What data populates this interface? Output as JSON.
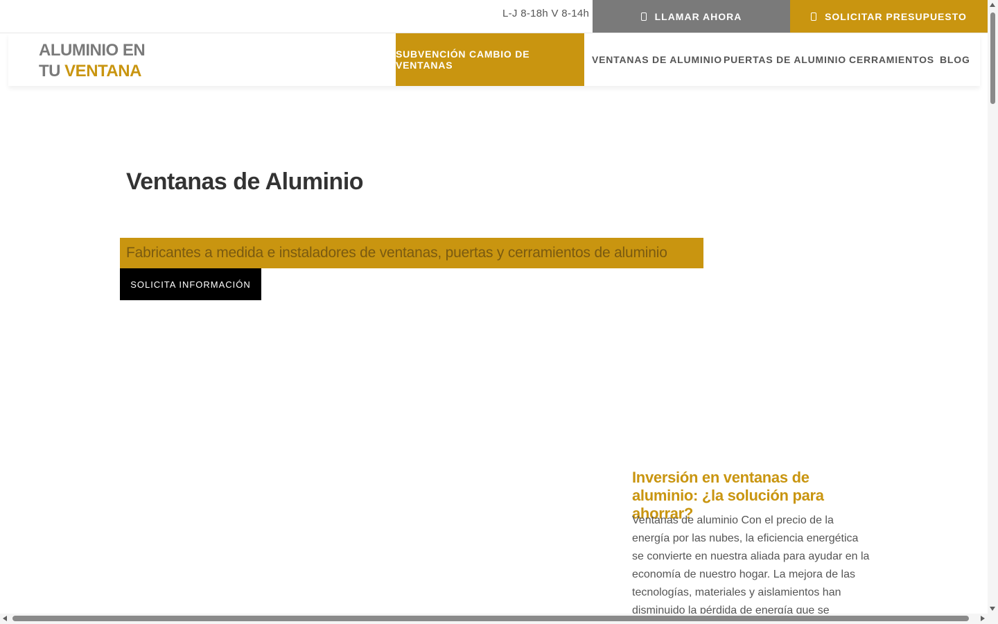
{
  "colors": {
    "accent": "#c99510",
    "gray_button": "#7a7a7a",
    "dark_button": "#000000",
    "text": "#333333"
  },
  "topbar": {
    "hours": "L-J 8-18h V 8-14h",
    "call_label": "LLAMAR AHORA",
    "call_icon": "phone-icon",
    "quote_label": "SOLICITAR PRESUPUESTO",
    "quote_icon": "document-icon"
  },
  "logo": {
    "line1": "ALUMINIO EN",
    "line2_prefix": "TU ",
    "line2_accent": "VENTANA"
  },
  "nav": {
    "items": [
      {
        "label": "SUBVENCIÓN CAMBIO DE VENTANAS",
        "active": true
      },
      {
        "label": "VENTANAS DE ALUMINIO"
      },
      {
        "label": "PUERTAS DE ALUMINIO"
      },
      {
        "label": "CERRAMIENTOS"
      },
      {
        "label": "BLOG"
      }
    ]
  },
  "hero": {
    "title": "Ventanas de Aluminio",
    "tagline": "Fabricantes a medida e instaladores de ventanas, puertas y cerramientos de aluminio",
    "cta_label": "SOLICITA INFORMACIÓN"
  },
  "article": {
    "title": "Inversión en ventanas de aluminio: ¿la solución para ahorrar?",
    "excerpt": "Ventanas de aluminio Con el precio de la energía por las nubes, la eficiencia energética se convierte en nuestra aliada para ayudar en la economía de nuestro hogar.  La mejora de las tecnologías, materiales y aislamientos han disminuido la pérdida de energía que se producía en las"
  }
}
